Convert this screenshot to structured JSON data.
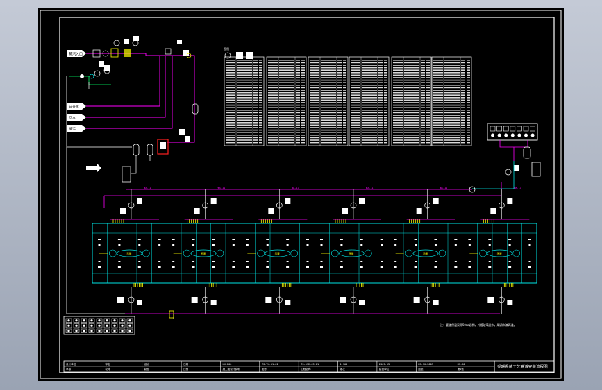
{
  "colors": {
    "background": "#000000",
    "frame": "#ffffff",
    "pipe_magenta": "#ff00ff",
    "building_cyan": "#00e5e5",
    "equipment_yellow": "#ffff00",
    "valve_green": "#00ff66",
    "highlight_red": "#ff2020"
  },
  "drawing": {
    "title": "采暖系统工艺管道安装流程图",
    "note": "注：管道保温采用50mm岩棉，外缠玻璃丝布，刷调和漆两道。"
  },
  "inlets": [
    {
      "label": "蒸汽入口"
    },
    {
      "label": "自来水"
    },
    {
      "label": "回水"
    },
    {
      "label": "排污"
    }
  ],
  "equipment": [
    {
      "tag": "TC"
    },
    {
      "tag": "PI"
    },
    {
      "tag": "FI"
    },
    {
      "tag": "LI"
    }
  ],
  "tables": {
    "header_label": "图例",
    "row_label": "WX-11",
    "count": 6
  },
  "building": {
    "bay_label": "采暖",
    "bays": 6
  },
  "title_block": {
    "cells": [
      [
        "设计单位",
        "审核"
      ],
      [
        "审定",
        "校对"
      ],
      [
        "设计",
        "制图"
      ],
      [
        "日期",
        "比例"
      ],
      [
        "XX-200",
        "施工图设计说明"
      ],
      [
        "ZS-TX-01-02",
        "图号"
      ],
      [
        "ZS-012-09-01",
        "工程名称"
      ],
      [
        "1:100",
        "版次"
      ],
      [
        "2009.03",
        "建设单位"
      ],
      [
        "XS-SK-2009",
        "图纸"
      ],
      [
        "XS-60",
        "第1张"
      ]
    ]
  }
}
